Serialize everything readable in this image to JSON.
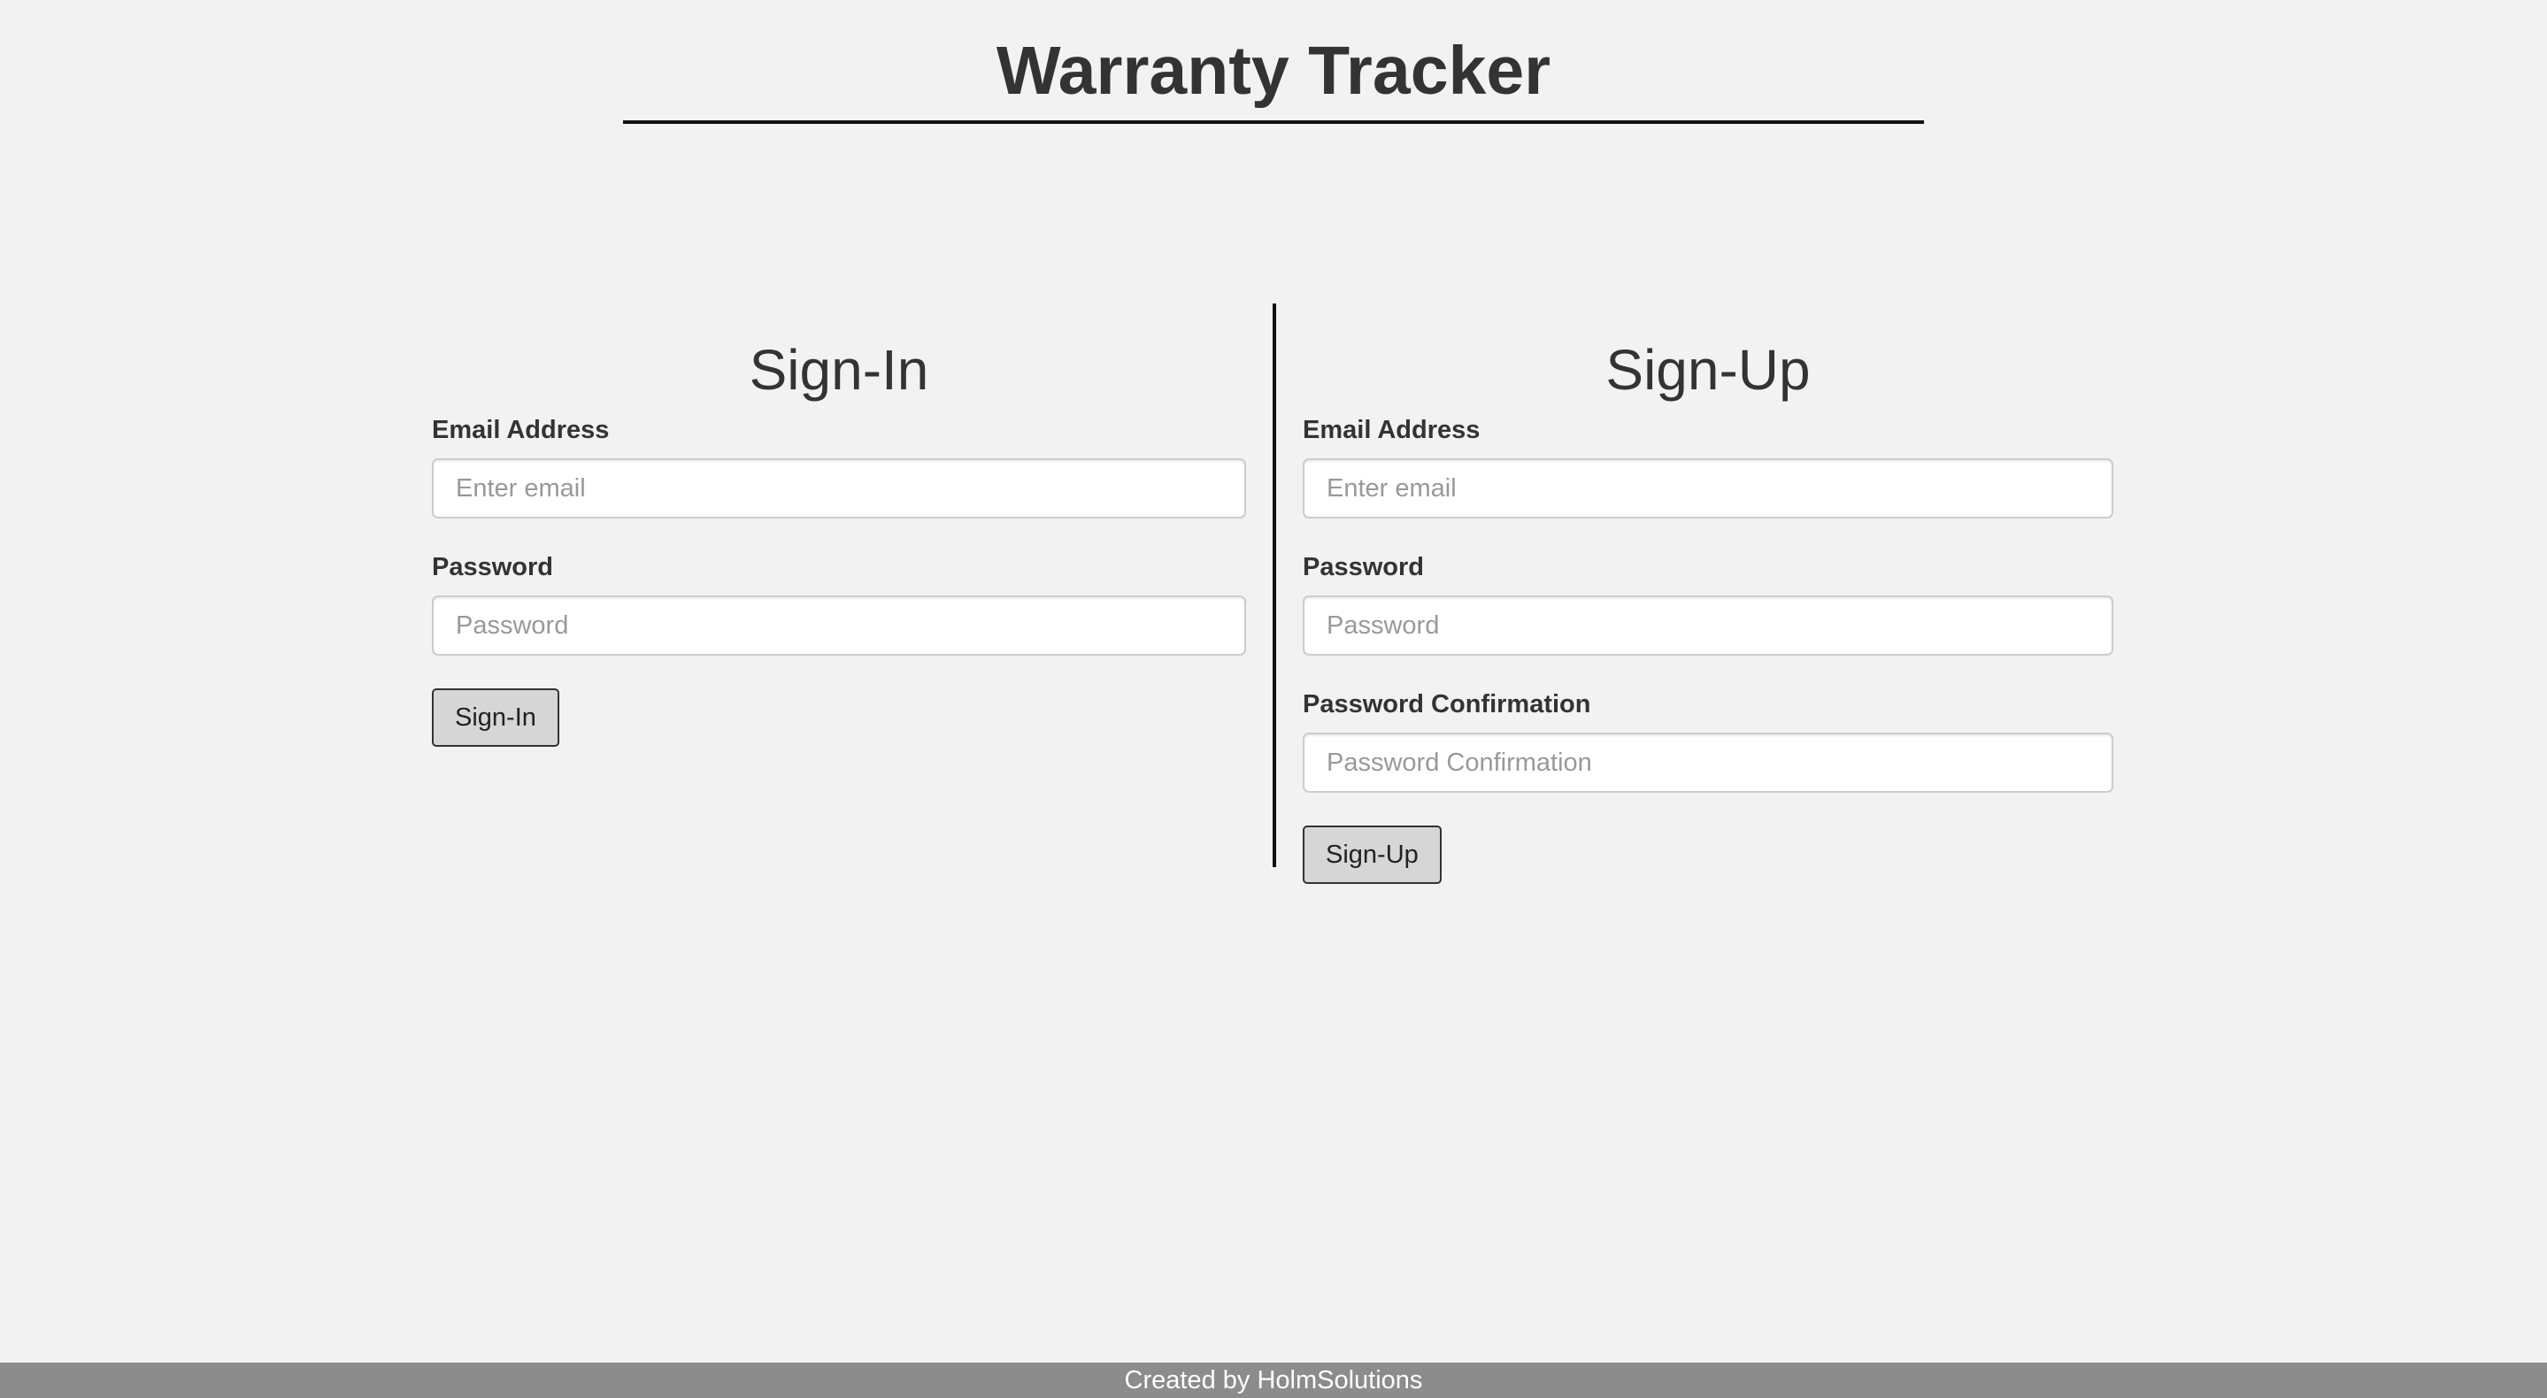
{
  "header": {
    "title": "Warranty Tracker"
  },
  "signin": {
    "heading": "Sign-In",
    "email_label": "Email Address",
    "email_placeholder": "Enter email",
    "password_label": "Password",
    "password_placeholder": "Password",
    "button_label": "Sign-In"
  },
  "signup": {
    "heading": "Sign-Up",
    "email_label": "Email Address",
    "email_placeholder": "Enter email",
    "password_label": "Password",
    "password_placeholder": "Password",
    "confirm_label": "Password Confirmation",
    "confirm_placeholder": "Password Confirmation",
    "button_label": "Sign-Up"
  },
  "footer": {
    "text": "Created by HolmSolutions"
  },
  "colors": {
    "background": "#f2f2f2",
    "footer_background": "#8c8c8c",
    "button_background": "#d6d6d6",
    "text": "#333333"
  }
}
